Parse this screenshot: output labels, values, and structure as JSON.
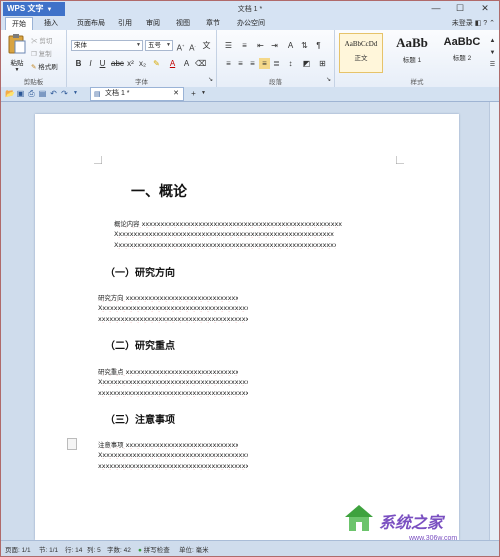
{
  "titlebar": {
    "app_button": "WPS 文字",
    "doc_title": "文档 1 *",
    "min": "—",
    "max": "☐",
    "close": "✕"
  },
  "menu": {
    "tabs": [
      "开始",
      "插入",
      "页面布局",
      "引用",
      "审阅",
      "视图",
      "章节",
      "办公空间"
    ],
    "active": "开始",
    "login": "未登录"
  },
  "ribbon": {
    "clipboard": {
      "paste": "粘贴",
      "cut": "剪切",
      "copy": "复制",
      "format_painter": "格式刷",
      "label": "剪贴板"
    },
    "font": {
      "name": "宋体",
      "size": "五号",
      "label": "字体"
    },
    "paragraph": {
      "label": "段落"
    },
    "styles": {
      "label": "样式",
      "items": [
        {
          "sample": "AaBbCcDd",
          "name": "正文"
        },
        {
          "sample": "AaBb",
          "name": "标题 1"
        },
        {
          "sample": "AaBbC",
          "name": "标题 2"
        }
      ]
    }
  },
  "doc_tab": {
    "label": "文档 1 *",
    "add": "+"
  },
  "document": {
    "title": "一、概论",
    "intro": [
      "概论内容 xxxxxxxxxxxxxxxxxxxxxxxxxxxxxxxxxxxxxxxxxxxxxxxxxxxxxxxxxxxxxxxxxxx",
      "Xxxxxxxxxxxxxxxxxxxxxxxxxxxxxxxxxxxxxxxxxxxxxxxxxxxxxxxxxxxxxxxxxxxxxxxxxx",
      "Xxxxxxxxxxxxxxxxxxxxxxxxxxxxxxxxxxxxxxxxxxxxxxxxxxxxxxxxxxxxxxxxxxxxxxxxxxx"
    ],
    "sections": [
      {
        "heading": "（一）研究方向",
        "lines": [
          "研究方向 xxxxxxxxxxxxxxxxxxxxxxxxxxxxxxxxxxxxxxx",
          "Xxxxxxxxxxxxxxxxxxxxxxxxxxxxxxxxxxxxxxxxxxxxxxxxxxxxx",
          "xxxxxxxxxxxxxxxxxxxxxxxxxxxxxxxxxxxxxxxxxxxxxxxxxxxxxx"
        ]
      },
      {
        "heading": "（二）研究重点",
        "lines": [
          "研究重点 xxxxxxxxxxxxxxxxxxxxxxxxxxxxxxxxxxxxxxx",
          "Xxxxxxxxxxxxxxxxxxxxxxxxxxxxxxxxxxxxxxxxxxxxxxxxxxxxx",
          "xxxxxxxxxxxxxxxxxxxxxxxxxxxxxxxxxxxxxxxxxxxxxxxxxxxxxx"
        ]
      },
      {
        "heading": "（三）注意事项",
        "lines": [
          "注意事项 xxxxxxxxxxxxxxxxxxxxxxxxxxxxxxxxxxxxxxx",
          "Xxxxxxxxxxxxxxxxxxxxxxxxxxxxxxxxxxxxxxxxxxxxxxxxxxxxx",
          "xxxxxxxxxxxxxxxxxxxxxxxxxxxxxxxxxxxxxxxxxxxxxxxxxxxxxx"
        ]
      }
    ]
  },
  "status": {
    "page": "页面: 1/1",
    "section": "节: 1/1",
    "line": "行: 14",
    "column": "列: 5",
    "words": "字数: 42",
    "spell": "拼写检查",
    "unit": "单位: 毫米"
  },
  "watermark": {
    "brand": "系统之家",
    "url": "www.306w.com"
  },
  "colors": {
    "accent": "#3f72c9",
    "squiggle": "#e04848",
    "ribbon_bg": "#e7eef8"
  }
}
